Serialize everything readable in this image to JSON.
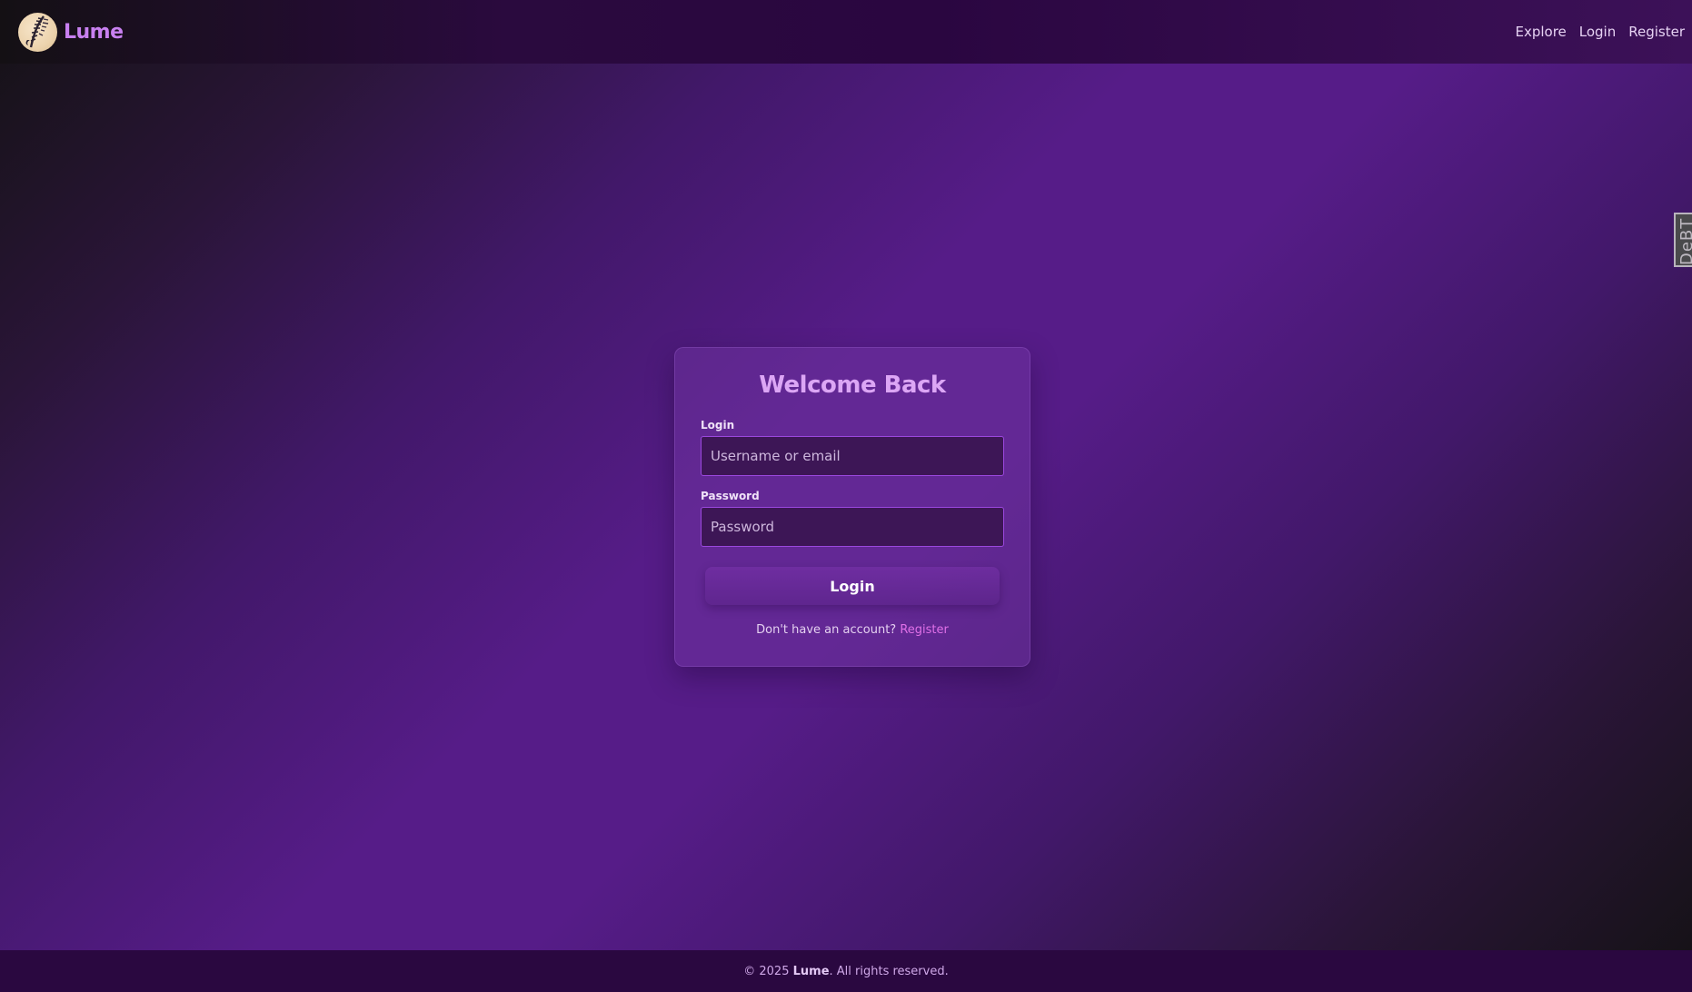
{
  "header": {
    "brand_name": "Lume",
    "nav": [
      {
        "label": "Explore"
      },
      {
        "label": "Login"
      },
      {
        "label": "Register"
      }
    ]
  },
  "side_tab": {
    "label": "DeBT"
  },
  "login_card": {
    "title": "Welcome Back",
    "login_label": "Login",
    "login_placeholder": "Username or email",
    "login_value": "",
    "password_label": "Password",
    "password_placeholder": "Password",
    "password_value": "",
    "submit_label": "Login",
    "signup_prompt": "Don't have an account?",
    "signup_link": "Register"
  },
  "footer": {
    "copyright": "© 2025",
    "brand": "Lume",
    "rights": ". All rights reserved."
  },
  "colors": {
    "brand_accent": "#c880f0",
    "title": "#dca6f5",
    "link": "#e070e8",
    "input_border": "#9b48de",
    "input_bg": "#3d1656"
  },
  "icons": {
    "logo": "feather-moon-logo-icon"
  }
}
